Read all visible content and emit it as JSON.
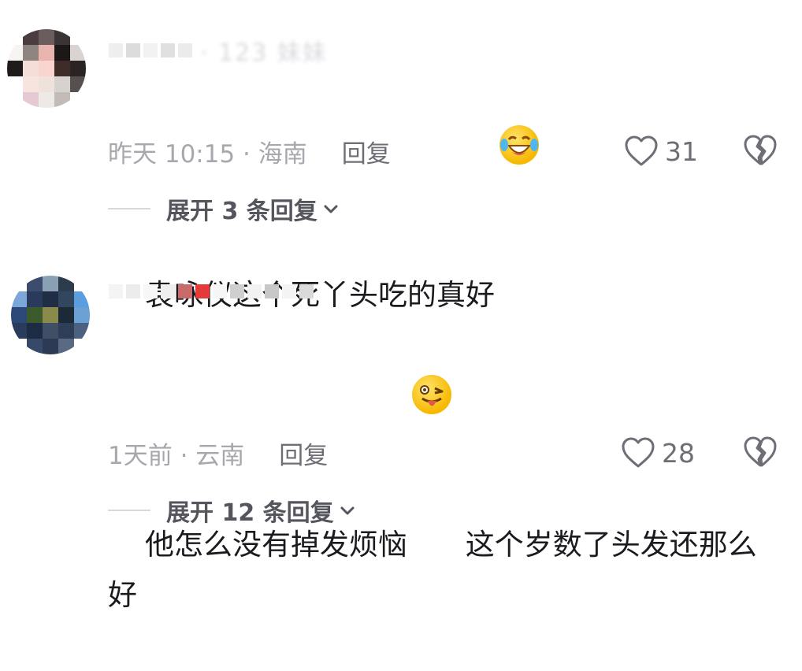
{
  "comments": [
    {
      "username_visible": "· 123 妹妹",
      "text_before_emoji": "袁咏仪这个死丫头吃的真好",
      "emoji": "laughing-tears-emoji",
      "text_after_emoji": "",
      "time_location": "昨天 10:15 · 海南",
      "reply_label": "回复",
      "likes": "31",
      "expand_label": "展开 3 条回复"
    },
    {
      "username_visible": "",
      "text_before_emoji": "他怎么没有掉发烦恼",
      "emoji": "winking-tongue-emoji",
      "text_after_emoji": " 这个岁数了头发还那么好",
      "time_location": "1天前 · 云南",
      "reply_label": "回复",
      "likes": "28",
      "expand_label": "展开 12 条回复"
    }
  ],
  "colors": {
    "text": "#1a1a1f",
    "meta": "#a7a7ae",
    "reply": "#6e6e76",
    "expand": "#55555d",
    "emoji_yellow": "#f6b800"
  }
}
